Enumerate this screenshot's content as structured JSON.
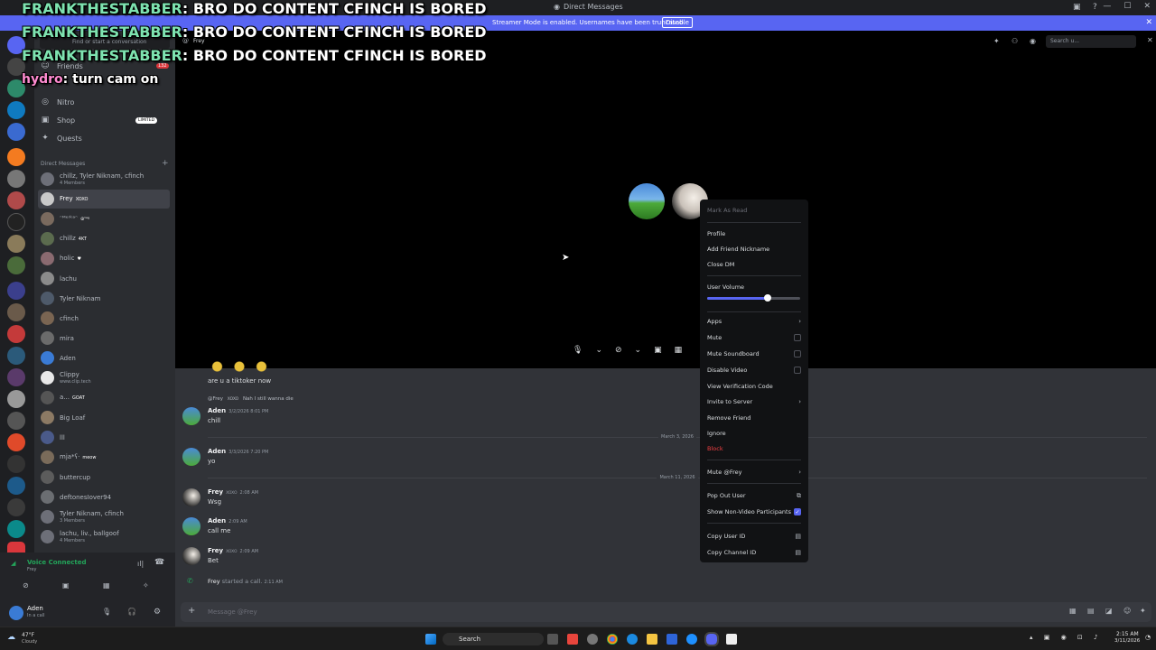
{
  "window": {
    "title": "Direct Messages"
  },
  "banner": {
    "text": "Streamer Mode is enabled. Usernames have been truncated.",
    "button": "Disable"
  },
  "sidebar": {
    "search_placeholder": "Find or start a conversation",
    "nav": [
      {
        "label": "Friends",
        "badge": "132"
      },
      {
        "label": "Nitro"
      },
      {
        "label": "Shop",
        "badge": "LIMITED"
      },
      {
        "label": "Quests"
      }
    ],
    "dm_header": "Direct Messages",
    "dms": [
      {
        "name": "chillz, Tyler Niknam, cfinch",
        "sub": "4 Members",
        "color": "#6d6f78"
      },
      {
        "name": "Frey",
        "badge": "XOXO",
        "color": "#c9c9c9"
      },
      {
        "name": "ᵔᴹᵉʳᵏᵃᵔ",
        "badge": "☮ᵗᵃᵍ",
        "color": "#7a6a5e"
      },
      {
        "name": "chillz",
        "badge": "4KT",
        "color": "#5b6b4e"
      },
      {
        "name": "holic",
        "badge": "♥",
        "color": "#8a6a70"
      },
      {
        "name": "lachu",
        "color": "#8b8b8b"
      },
      {
        "name": "Tyler Niknam",
        "color": "#4e5a6a"
      },
      {
        "name": "cfinch",
        "color": "#7a6552"
      },
      {
        "name": "mira",
        "color": "#6b6b6b"
      },
      {
        "name": "Aden",
        "color": "#3a7bd5"
      },
      {
        "name": "Clippy",
        "sub": "www.clip.tech",
        "color": "#e8e8e8"
      },
      {
        "name": "a...",
        "badge": "GOAT",
        "color": "#555"
      },
      {
        "name": "Big Loaf",
        "color": "#8c7a64"
      },
      {
        "name": "lll",
        "color": "#4a5a8a"
      },
      {
        "name": "mja*ʕ·",
        "badge": "meow",
        "color": "#7a6b5a"
      },
      {
        "name": "buttercup",
        "color": "#5c5c5c"
      },
      {
        "name": "deftonesIover94",
        "color": "#6b6e72"
      },
      {
        "name": "Tyler Niknam, cfinch",
        "sub": "3 Members",
        "color": "#6d6f78"
      },
      {
        "name": "lachu, liv., ballgoof",
        "sub": "4 Members",
        "color": "#6d6f78"
      }
    ],
    "voice": {
      "status": "Voice Connected",
      "channel": "Frey"
    },
    "user": {
      "name": "Aden",
      "status": "In a call"
    }
  },
  "header": {
    "name": "Frey",
    "search_placeholder": "Search u..."
  },
  "chat": {
    "top_text": "are u a tiktoker now",
    "reply": {
      "to": "@Frey",
      "badge": "XOXO",
      "text": "Nah I still wanna die"
    },
    "messages": [
      {
        "author": "Aden",
        "time": "3/2/2026 8:01 PM",
        "text": "chill"
      },
      {
        "author": "Aden",
        "time": "3/3/2026 7:20 PM",
        "text": "yo"
      },
      {
        "author": "Frey",
        "badge": "XOXO",
        "time": "2:08 AM",
        "text": "Wsg"
      },
      {
        "author": "Aden",
        "time": "2:09 AM",
        "text": "call me"
      },
      {
        "author": "Frey",
        "badge": "XOXO",
        "time": "2:09 AM",
        "text": "Bet"
      }
    ],
    "dates": [
      "March 3, 2026",
      "March 11, 2026"
    ],
    "call_event": {
      "author": "Frey",
      "text": "started a call.",
      "time": "2:11 AM"
    },
    "input_placeholder": "Message @Frey"
  },
  "context_menu": {
    "header": "Mark As Read",
    "items": [
      "Profile",
      "Add Friend Nickname",
      "Close DM"
    ],
    "volume_label": "User Volume",
    "volume_level": 0.65,
    "submenu_items": [
      "Apps"
    ],
    "checks": [
      {
        "label": "Mute",
        "checked": false
      },
      {
        "label": "Mute Soundboard",
        "checked": false
      },
      {
        "label": "Disable Video",
        "checked": false
      }
    ],
    "more": [
      "View Verification Code",
      "Invite to Server",
      "Remove Friend",
      "Ignore",
      "Block"
    ],
    "mute_user": "Mute @Frey",
    "pop_out": "Pop Out User",
    "show_non_video": "Show Non-Video Participants",
    "copy_user": "Copy User ID",
    "copy_channel": "Copy Channel ID"
  },
  "overlay_chat": [
    {
      "user": "FRANKTHESTABBER",
      "text": "BRO DO CONTENT CFINCH IS BORED"
    },
    {
      "user": "FRANKTHESTABBER",
      "text": "BRO DO CONTENT CFINCH IS BORED"
    },
    {
      "user": "FRANKTHESTABBER",
      "text": "BRO DO CONTENT CFINCH IS BORED"
    },
    {
      "user": "hydro",
      "text": "turn cam on"
    }
  ],
  "taskbar": {
    "search": "Search",
    "weather_temp": "47°F",
    "weather_desc": "Cloudy",
    "time": "2:15 AM",
    "date": "3/11/2026"
  }
}
